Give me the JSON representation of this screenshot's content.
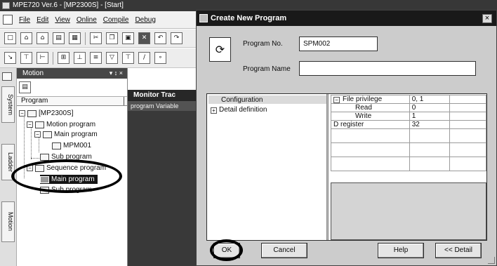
{
  "app": {
    "title": "MPE720 Ver.6 - [MP2300S] - [Start]",
    "menu": [
      "File",
      "Edit",
      "View",
      "Online",
      "Compile",
      "Debug"
    ],
    "menu_underline_letters": [
      "F",
      "E",
      "V",
      "O",
      "C",
      "D"
    ]
  },
  "dock_tabs": [
    "System",
    "Ladder",
    "Motion"
  ],
  "motion_pane": {
    "title": "Motion",
    "controls": "▾ ↕ ×",
    "column_header": "Program",
    "tree": [
      {
        "label": "[MP2300S]",
        "level": 0
      },
      {
        "label": "Motion program",
        "level": 1
      },
      {
        "label": "Main program",
        "level": 2
      },
      {
        "label": "MPM001",
        "level": 3
      },
      {
        "label": "Sub program",
        "level": 2
      },
      {
        "label": "Sequence program",
        "level": 1
      },
      {
        "label": "Main program",
        "level": 2,
        "selected": true
      },
      {
        "label": "Sub program",
        "level": 2
      }
    ]
  },
  "monitor_strip": {
    "head": "Monitor  Trac",
    "sub": "program   Variable"
  },
  "dialog": {
    "title": "Create New Program",
    "close": "×",
    "program_no_label": "Program No.",
    "program_no_value": "SPM002",
    "program_name_label": "Program Name",
    "program_name_value": "",
    "tree": [
      {
        "label": "Configuration",
        "selected": true
      },
      {
        "label": "Detail definition",
        "expander": "+"
      }
    ],
    "properties": [
      {
        "key": "File privilege",
        "value": "0, 1",
        "expander": "−",
        "indent": false
      },
      {
        "key": "Read",
        "value": "0",
        "indent": true
      },
      {
        "key": "Write",
        "value": "1",
        "indent": true
      },
      {
        "key": "D register",
        "value": "32",
        "indent": false
      },
      {
        "key": "",
        "value": ""
      },
      {
        "key": "",
        "value": ""
      },
      {
        "key": "",
        "value": ""
      },
      {
        "key": "",
        "value": ""
      }
    ],
    "buttons": {
      "ok": "OK",
      "cancel": "Cancel",
      "help": "Help",
      "detail": "<< Detail"
    }
  }
}
